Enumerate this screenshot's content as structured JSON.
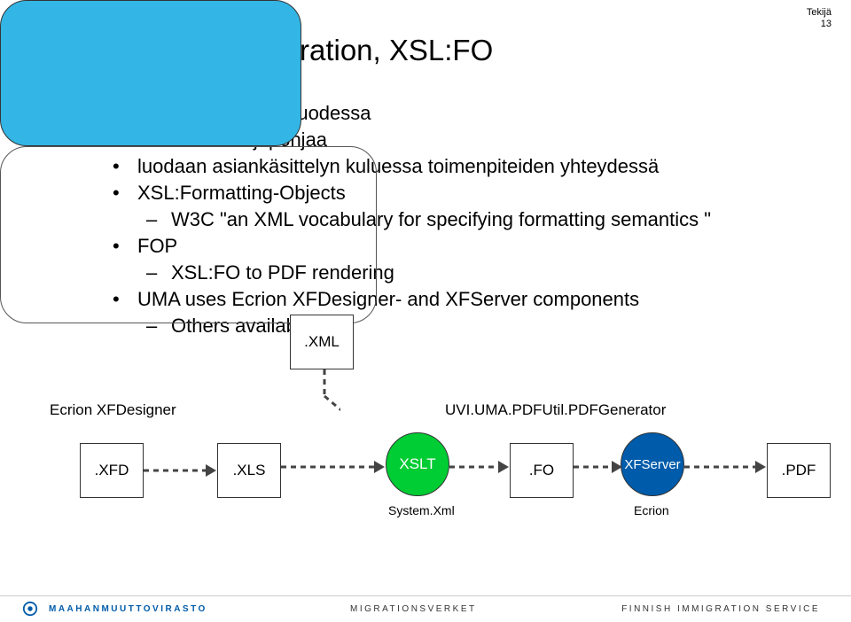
{
  "meta": {
    "author": "Tekijä",
    "page": "13"
  },
  "title": "Document generation,  XSL:FO",
  "bullets": {
    "a1": "~1milj. asiakirjaa vuodessa",
    "a2": "n. 200 asiakirjapohjaa",
    "a3": "luodaan asiankäsittelyn kuluessa toimenpiteiden yhteydessä",
    "a4": "XSL:Formatting-Objects",
    "a4_1": "W3C \"an XML vocabulary for specifying formatting semantics \"",
    "a5": "FOP",
    "a5_1": "XSL:FO to PDF rendering",
    "a6": "UMA uses Ecrion XFDesigner- and XFServer components",
    "a6_1": "Others available, too"
  },
  "diagram": {
    "xml": ".XML",
    "designer": "Ecrion XFDesigner",
    "generator": "UVI.UMA.PDFUtil.PDFGenerator",
    "xfd": ".XFD",
    "xls": ".XLS",
    "xslt": "XSLT",
    "fo": ".FO",
    "xfserver": "XFServer",
    "pdf": ".PDF",
    "systemxml": "System.Xml",
    "ecrion": "Ecrion"
  },
  "footer": {
    "left": "MAAHANMUUTTOVIRASTO",
    "mid": "MIGRATIONSVERKET",
    "right": "FINNISH IMMIGRATION SERVICE"
  }
}
